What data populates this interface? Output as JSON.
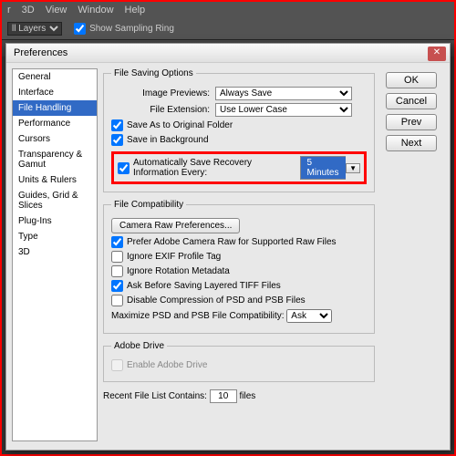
{
  "menu": {
    "items": [
      "r",
      "3D",
      "View",
      "Window",
      "Help"
    ]
  },
  "toolbar": {
    "layers": "ll Layers",
    "sampling": "Show Sampling Ring"
  },
  "dialog": {
    "title": "Preferences"
  },
  "sidebar": {
    "items": [
      "General",
      "Interface",
      "File Handling",
      "Performance",
      "Cursors",
      "Transparency & Gamut",
      "Units & Rulers",
      "Guides, Grid & Slices",
      "Plug-Ins",
      "Type",
      "3D"
    ],
    "selected": 2
  },
  "buttons": {
    "ok": "OK",
    "cancel": "Cancel",
    "prev": "Prev",
    "next": "Next"
  },
  "saving": {
    "legend": "File Saving Options",
    "imgprev_lbl": "Image Previews:",
    "imgprev_val": "Always Save",
    "fileext_lbl": "File Extension:",
    "fileext_val": "Use Lower Case",
    "saveas": "Save As to Original Folder",
    "savebg": "Save in Background",
    "auto_lbl": "Automatically Save Recovery Information Every:",
    "auto_val": "5 Minutes"
  },
  "compat": {
    "legend": "File Compatibility",
    "camraw": "Camera Raw Preferences...",
    "prefer": "Prefer Adobe Camera Raw for Supported Raw Files",
    "exif": "Ignore EXIF Profile Tag",
    "rot": "Ignore Rotation Metadata",
    "tiff": "Ask Before Saving Layered TIFF Files",
    "psd": "Disable Compression of PSD and PSB Files",
    "max_lbl": "Maximize PSD and PSB File Compatibility:",
    "max_val": "Ask"
  },
  "drive": {
    "legend": "Adobe Drive",
    "enable": "Enable Adobe Drive"
  },
  "recent": {
    "lbl": "Recent File List Contains:",
    "val": "10",
    "suffix": "files"
  }
}
